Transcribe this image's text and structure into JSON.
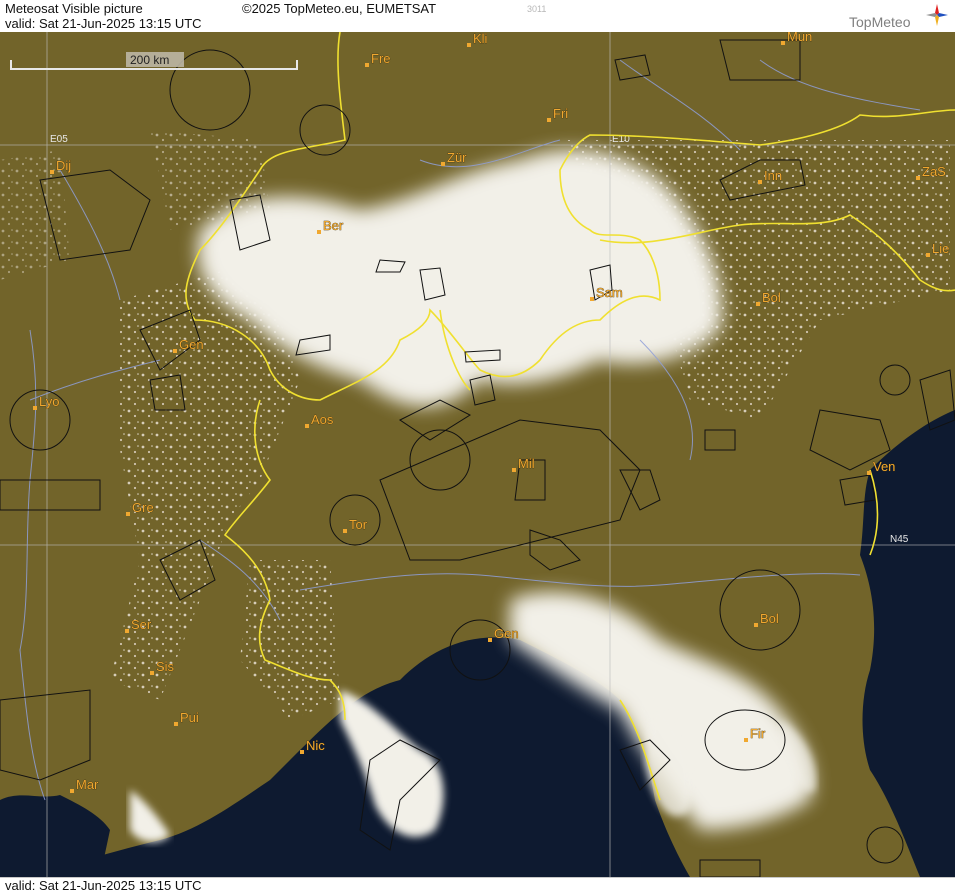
{
  "header": {
    "title": "Meteosat Visible picture",
    "valid": "valid:  Sat  21-Jun-2025  13:15 UTC",
    "copyright": "©2025 TopMeteo.eu, EUMETSAT",
    "code": "3011",
    "logo": "TopMeteo"
  },
  "footer": {
    "valid": "valid:  Sat  21-Jun-2025  13:15 UTC"
  },
  "map": {
    "scale_bar": "200 km",
    "grid_labels": [
      "E05",
      "E10",
      "N45"
    ],
    "cities": [
      {
        "key": "kli",
        "label": "Kli"
      },
      {
        "key": "mun",
        "label": "Mun"
      },
      {
        "key": "fre",
        "label": "Fre"
      },
      {
        "key": "fri",
        "label": "Fri"
      },
      {
        "key": "zur",
        "label": "Zür"
      },
      {
        "key": "dij",
        "label": "Dij"
      },
      {
        "key": "inn",
        "label": "Inn"
      },
      {
        "key": "zas",
        "label": "ZaS"
      },
      {
        "key": "ber",
        "label": "Ber"
      },
      {
        "key": "lie",
        "label": "Lie"
      },
      {
        "key": "sam",
        "label": "Sam"
      },
      {
        "key": "bol1",
        "label": "Bol"
      },
      {
        "key": "gen1",
        "label": "Gen"
      },
      {
        "key": "lyo",
        "label": "Lyo"
      },
      {
        "key": "aos",
        "label": "Aos"
      },
      {
        "key": "mil",
        "label": "Mil"
      },
      {
        "key": "ven",
        "label": "Ven"
      },
      {
        "key": "gre",
        "label": "Gre"
      },
      {
        "key": "tor",
        "label": "Tor"
      },
      {
        "key": "ser",
        "label": "Ser"
      },
      {
        "key": "bol2",
        "label": "Bol"
      },
      {
        "key": "gen2",
        "label": "Gen"
      },
      {
        "key": "sis",
        "label": "Sis"
      },
      {
        "key": "pui",
        "label": "Pui"
      },
      {
        "key": "nic",
        "label": "Nic"
      },
      {
        "key": "fir",
        "label": "Fir"
      },
      {
        "key": "mar",
        "label": "Mar"
      }
    ],
    "colors": {
      "land": "#6f6228",
      "sea": "#0e1a30",
      "cloud": "#f2f0e8",
      "border": "#f0e030",
      "airspace": "#111111",
      "river": "#8f9fd8",
      "grid": "#bdbdbd",
      "city": "#f0a830"
    }
  }
}
